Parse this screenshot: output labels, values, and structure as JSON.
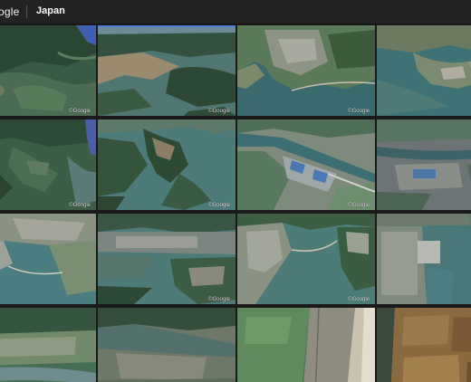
{
  "header": {
    "brand": "ogle",
    "breadcrumb": "Japan"
  },
  "tiles": [
    {
      "watermark": "©Google",
      "kind": "forest-coast",
      "tone": "dark"
    },
    {
      "watermark": "©Google",
      "kind": "bay-hills",
      "tone": "mid"
    },
    {
      "watermark": "©Google",
      "kind": "coast-city",
      "tone": "mid"
    },
    {
      "watermark": "",
      "kind": "river-delta",
      "tone": "light"
    },
    {
      "watermark": "©Google",
      "kind": "forest-bay",
      "tone": "dark"
    },
    {
      "watermark": "©Google",
      "kind": "peninsula",
      "tone": "mid"
    },
    {
      "watermark": "©Google",
      "kind": "industrial-port",
      "tone": "light"
    },
    {
      "watermark": "",
      "kind": "urban-river",
      "tone": "grey"
    },
    {
      "watermark": "",
      "kind": "harbor-city",
      "tone": "light"
    },
    {
      "watermark": "©Google",
      "kind": "oblique-bay",
      "tone": "mid"
    },
    {
      "watermark": "©Google",
      "kind": "harbor-hills",
      "tone": "mid"
    },
    {
      "watermark": "",
      "kind": "port-grid",
      "tone": "grey"
    },
    {
      "watermark": "",
      "kind": "river-mouth",
      "tone": "dark"
    },
    {
      "watermark": "",
      "kind": "lowland",
      "tone": "mid"
    },
    {
      "watermark": "",
      "kind": "fields-beach",
      "tone": "light"
    },
    {
      "watermark": "",
      "kind": "brown-fields",
      "tone": "brown"
    }
  ],
  "colors": {
    "background": "#1a1a1a",
    "topbar": "#232323",
    "selection_accent": "#4a7fd6"
  }
}
